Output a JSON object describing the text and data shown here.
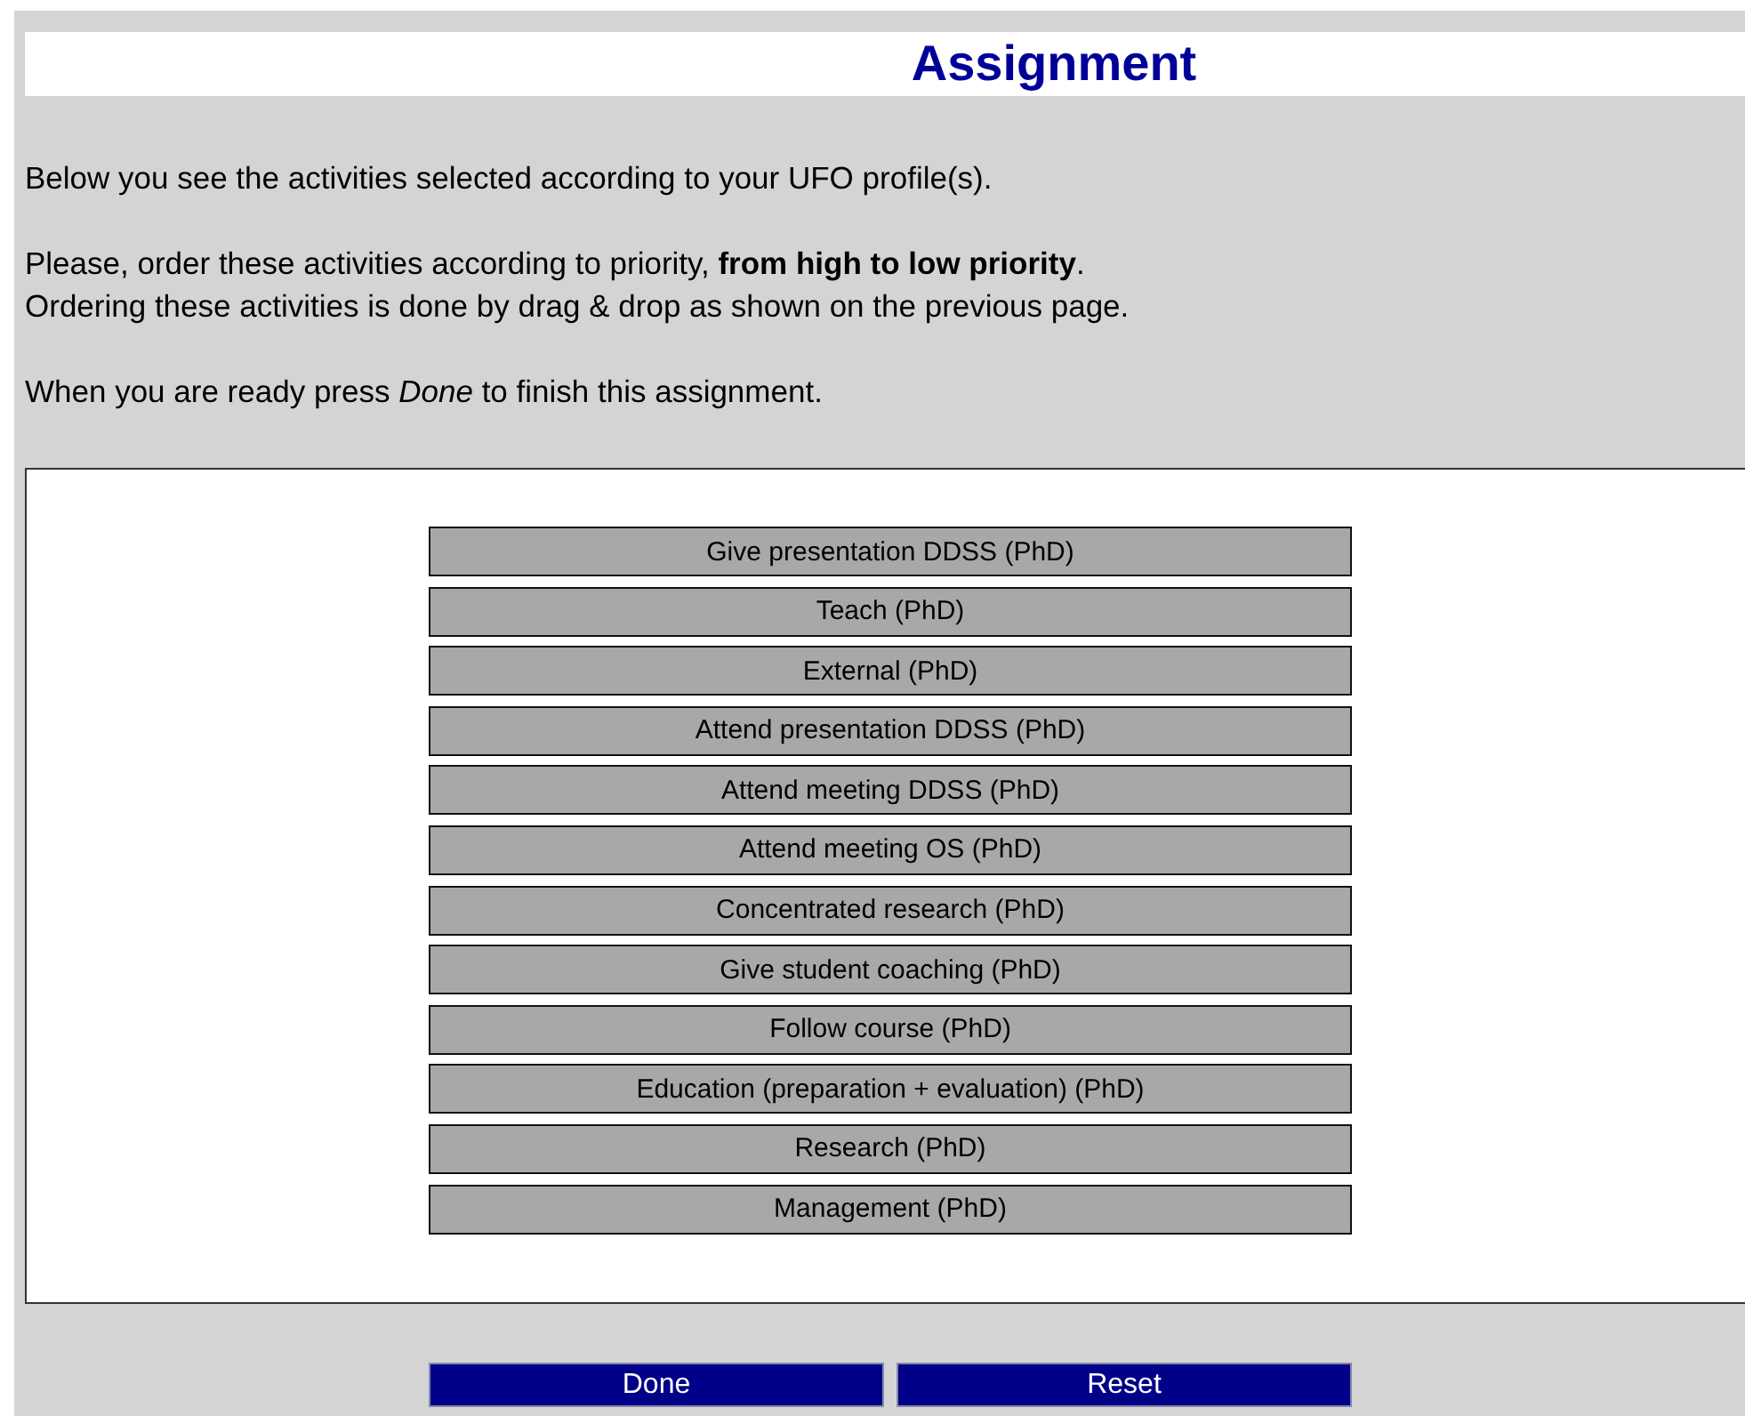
{
  "title": "Assignment",
  "paragraphs": [
    "Below you see the activities selected according to your UFO profile(s).",
    "Please, order these activities according to priority, **from high to low priority**.\nOrdering these activities is done by drag & drop as shown on the previous page.",
    "When you are ready press *Done* to finish this assignment."
  ],
  "activities": [
    "Give presentation DDSS (PhD)",
    "Teach (PhD)",
    "External (PhD)",
    "Attend presentation DDSS (PhD)",
    "Attend meeting DDSS (PhD)",
    "Attend meeting OS (PhD)",
    "Concentrated research (PhD)",
    "Give student coaching (PhD)",
    "Follow course (PhD)",
    "Education (preparation + evaluation) (PhD)",
    "Research (PhD)",
    "Management (PhD)"
  ],
  "buttons": [
    "Done",
    "Reset"
  ]
}
